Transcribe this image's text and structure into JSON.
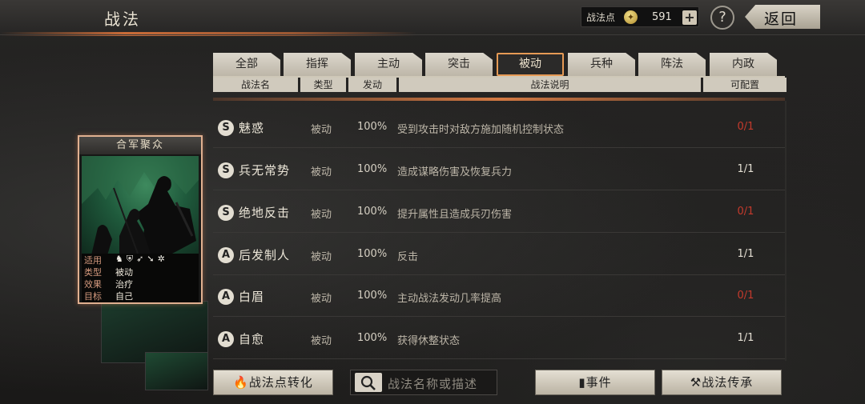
{
  "header": {
    "title": "战法",
    "points_label": "战法点",
    "points_value": "591",
    "plus_label": "+",
    "help_label": "?",
    "back_label": "返回"
  },
  "tabs": [
    {
      "label": "全部",
      "active": false
    },
    {
      "label": "指挥",
      "active": false
    },
    {
      "label": "主动",
      "active": false
    },
    {
      "label": "突击",
      "active": false
    },
    {
      "label": "被动",
      "active": true
    },
    {
      "label": "兵种",
      "active": false
    },
    {
      "label": "阵法",
      "active": false
    },
    {
      "label": "内政",
      "active": false
    }
  ],
  "columns": [
    "战法名",
    "类型",
    "发动",
    "战法说明",
    "可配置"
  ],
  "rows": [
    {
      "grade": "S",
      "name": "魅惑",
      "type": "被动",
      "rate": "100%",
      "desc": "受到攻击时对敌方施加随机控制状态",
      "config": "0/1",
      "config_red": true
    },
    {
      "grade": "S",
      "name": "兵无常势",
      "type": "被动",
      "rate": "100%",
      "desc": "造成谋略伤害及恢复兵力",
      "config": "1/1",
      "config_red": false
    },
    {
      "grade": "S",
      "name": "绝地反击",
      "type": "被动",
      "rate": "100%",
      "desc": "提升属性且造成兵刃伤害",
      "config": "0/1",
      "config_red": true
    },
    {
      "grade": "A",
      "name": "后发制人",
      "type": "被动",
      "rate": "100%",
      "desc": "反击",
      "config": "1/1",
      "config_red": false
    },
    {
      "grade": "A",
      "name": "白眉",
      "type": "被动",
      "rate": "100%",
      "desc": "主动战法发动几率提高",
      "config": "0/1",
      "config_red": true
    },
    {
      "grade": "A",
      "name": "自愈",
      "type": "被动",
      "rate": "100%",
      "desc": "获得休整状态",
      "config": "1/1",
      "config_red": false
    }
  ],
  "card": {
    "title": "合军聚众",
    "fit_label": "适用",
    "type_label": "类型",
    "type_value": "被动",
    "effect_label": "效果",
    "effect_value": "治疗",
    "target_label": "目标",
    "target_value": "自己",
    "fit_icons": [
      "horse-icon",
      "shield-icon",
      "bow-icon",
      "spear-icon",
      "siege-icon"
    ]
  },
  "footer": {
    "convert_label": "战法点转化",
    "search_placeholder": "战法名称或描述",
    "events_label": "事件",
    "inherit_label": "战法传承"
  },
  "colors": {
    "accent_orange": "#e69a55",
    "config_red": "#c53a2c",
    "card_border": "#e0b090"
  }
}
